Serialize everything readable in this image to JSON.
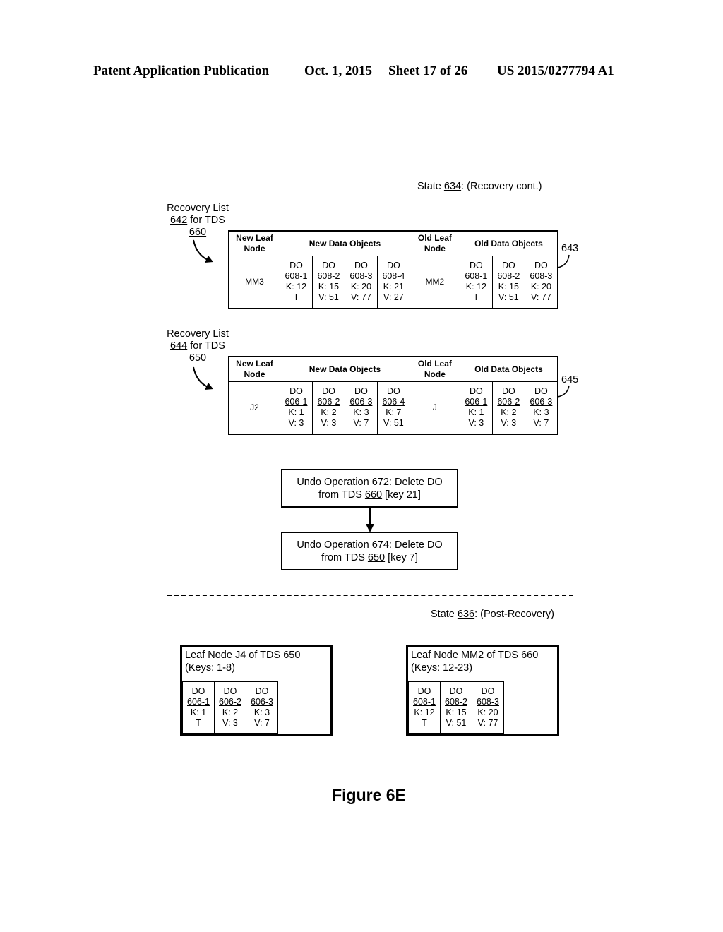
{
  "header": {
    "left": "Patent Application Publication",
    "date": "Oct. 1, 2015",
    "sheet": "Sheet 17 of 26",
    "pub_number": "US 2015/0277794 A1"
  },
  "state_634": {
    "prefix": "State ",
    "ref": "634",
    "suffix": ": (Recovery cont.)"
  },
  "recovery_list_642": {
    "line1": "Recovery List",
    "ref": "642",
    "line2_suffix": " for TDS",
    "tds_ref": "660",
    "table_ref": "643",
    "headers": {
      "new_leaf": "New Leaf Node",
      "new_dos": "New Data Objects",
      "old_leaf": "Old Leaf Node",
      "old_dos": "Old Data Objects"
    },
    "new_leaf_node": "MM3",
    "new_data_objects": [
      {
        "label": "DO",
        "id": "608-1",
        "k": "K: 12",
        "v": "T"
      },
      {
        "label": "DO",
        "id": "608-2",
        "k": "K: 15",
        "v": "V: 51"
      },
      {
        "label": "DO",
        "id": "608-3",
        "k": "K: 20",
        "v": "V: 77"
      },
      {
        "label": "DO",
        "id": "608-4",
        "k": "K: 21",
        "v": "V: 27"
      }
    ],
    "old_leaf_node": "MM2",
    "old_data_objects": [
      {
        "label": "DO",
        "id": "608-1",
        "k": "K: 12",
        "v": "T"
      },
      {
        "label": "DO",
        "id": "608-2",
        "k": "K: 15",
        "v": "V: 51"
      },
      {
        "label": "DO",
        "id": "608-3",
        "k": "K: 20",
        "v": "V: 77"
      }
    ]
  },
  "recovery_list_644": {
    "line1": "Recovery List",
    "ref": "644",
    "line2_suffix": " for TDS",
    "tds_ref": "650",
    "table_ref": "645",
    "headers": {
      "new_leaf": "New Leaf Node",
      "new_dos": "New Data Objects",
      "old_leaf": "Old Leaf Node",
      "old_dos": "Old Data Objects"
    },
    "new_leaf_node": "J2",
    "new_data_objects": [
      {
        "label": "DO",
        "id": "606-1",
        "k": "K: 1",
        "v": "V: 3"
      },
      {
        "label": "DO",
        "id": "606-2",
        "k": "K: 2",
        "v": "V: 3"
      },
      {
        "label": "DO",
        "id": "606-3",
        "k": "K: 3",
        "v": "V: 7"
      },
      {
        "label": "DO",
        "id": "606-4",
        "k": "K: 7",
        "v": "V: 51"
      }
    ],
    "old_leaf_node": "J",
    "old_data_objects": [
      {
        "label": "DO",
        "id": "606-1",
        "k": "K: 1",
        "v": "V: 3"
      },
      {
        "label": "DO",
        "id": "606-2",
        "k": "K: 2",
        "v": "V: 3"
      },
      {
        "label": "DO",
        "id": "606-3",
        "k": "K: 3",
        "v": "V: 7"
      }
    ]
  },
  "undo_ops": [
    {
      "prefix": "Undo Operation ",
      "ref": "672",
      "mid": ": Delete DO",
      "line2_prefix": "from TDS ",
      "tds_ref": "660",
      "line2_suffix": " [key 21]"
    },
    {
      "prefix": "Undo Operation ",
      "ref": "674",
      "mid": ": Delete DO",
      "line2_prefix": "from TDS ",
      "tds_ref": "650",
      "line2_suffix": " [key 7]"
    }
  ],
  "state_636": {
    "prefix": "State ",
    "ref": "636",
    "suffix": ": (Post-Recovery)"
  },
  "leaf_j4": {
    "title_prefix": "Leaf Node J4 of TDS ",
    "tds_ref": "650",
    "keys": "(Keys: 1-8)",
    "data_objects": [
      {
        "label": "DO",
        "id": "606-1",
        "k": "K: 1",
        "v": "T"
      },
      {
        "label": "DO",
        "id": "606-2",
        "k": "K: 2",
        "v": "V: 3"
      },
      {
        "label": "DO",
        "id": "606-3",
        "k": "K: 3",
        "v": "V: 7"
      }
    ]
  },
  "leaf_mm2": {
    "title_prefix": "Leaf Node MM2 of TDS ",
    "tds_ref": "660",
    "keys": "(Keys: 12-23)",
    "data_objects": [
      {
        "label": "DO",
        "id": "608-1",
        "k": "K: 12",
        "v": "T"
      },
      {
        "label": "DO",
        "id": "608-2",
        "k": "K: 15",
        "v": "V: 51"
      },
      {
        "label": "DO",
        "id": "608-3",
        "k": "K: 20",
        "v": "V: 77"
      }
    ]
  },
  "figure_label": "Figure 6E"
}
